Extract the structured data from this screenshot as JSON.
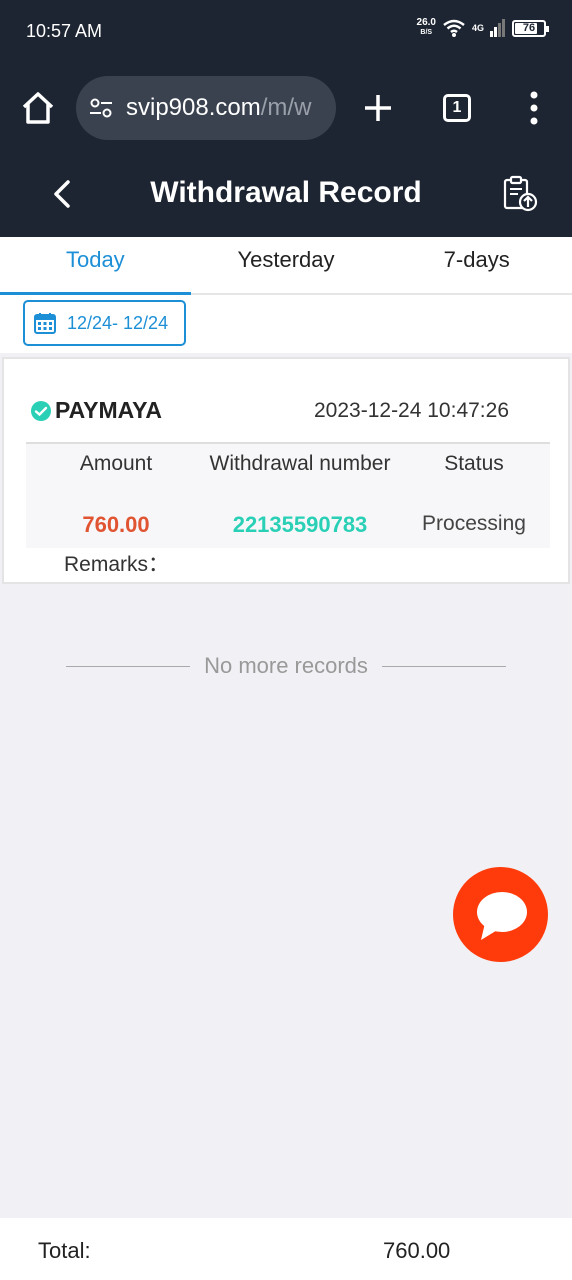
{
  "status_bar": {
    "time": "10:57 AM",
    "net_speed": "26.0",
    "net_speed_unit": "B/S",
    "network": "4G",
    "battery": "76",
    "battery_fraction": 0.76
  },
  "browser": {
    "url_main": "svip908.com",
    "url_path": "/m/w",
    "tab_count": "1",
    "icons": [
      "home-icon",
      "site-settings-icon",
      "plus-icon",
      "tabs-icon",
      "more-vert-icon"
    ]
  },
  "header": {
    "title": "Withdrawal Record",
    "icons": [
      "chevron-left-icon",
      "clipboard-upload-icon"
    ]
  },
  "tabs": [
    {
      "label": "Today",
      "active": true
    },
    {
      "label": "Yesterday",
      "active": false
    },
    {
      "label": "7-days",
      "active": false
    }
  ],
  "filter": {
    "date_range": "12/24- 12/24",
    "icon": "calendar-icon"
  },
  "record": {
    "method": "PAYMAYA",
    "datetime": "2023-12-24 10:47:26",
    "headers": {
      "amount": "Amount",
      "number": "Withdrawal number",
      "status": "Status"
    },
    "amount": "760.00",
    "withdrawal_number": "22135590783",
    "status": "Processing",
    "remarks_label": "Remarks："
  },
  "list_end": "No more records",
  "footer": {
    "total_label": "Total:",
    "total_value": "760.00"
  },
  "colors": {
    "header_bg": "#1d2532",
    "accent": "#1d8fd6",
    "amount": "#e15432",
    "number": "#2ad0b6",
    "chat": "#ff3b0b"
  }
}
